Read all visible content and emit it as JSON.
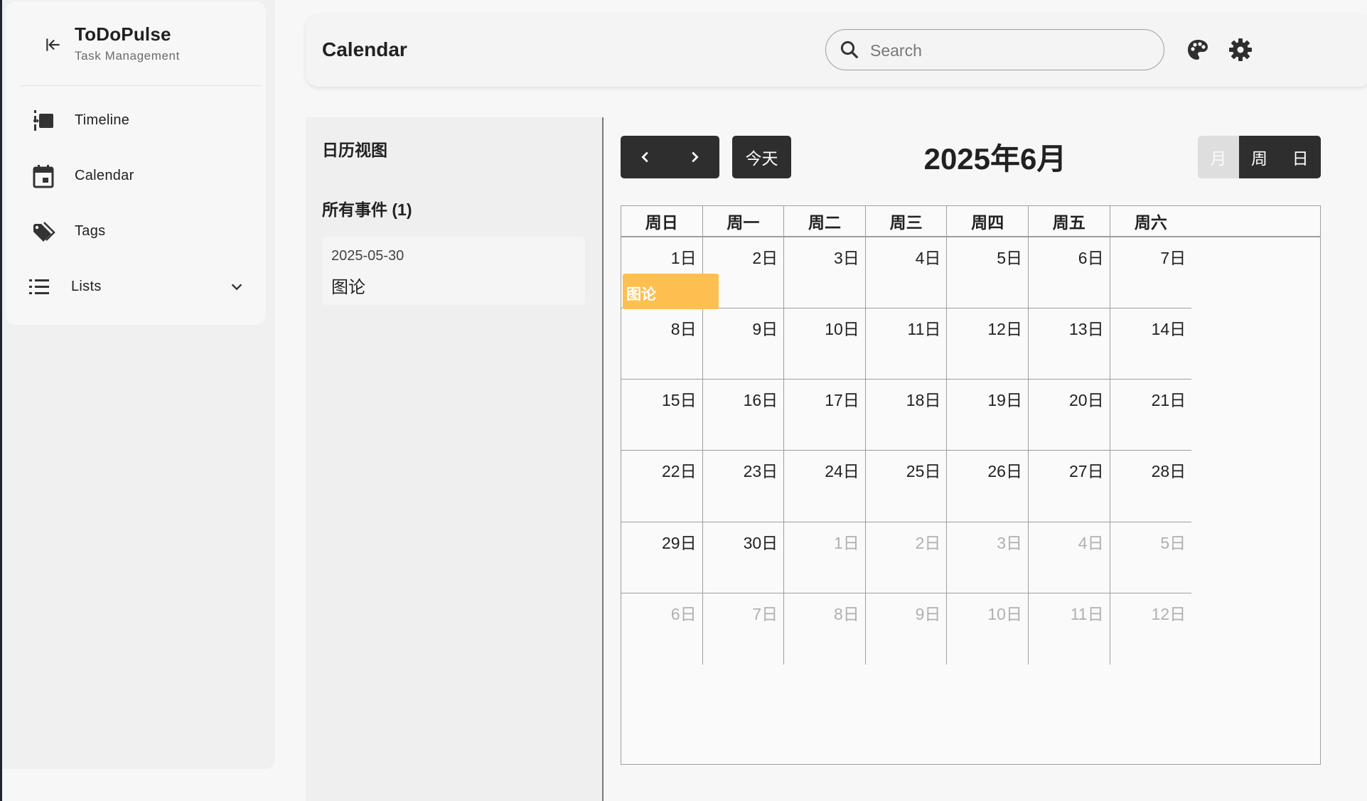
{
  "app": {
    "title": "ToDoPulse",
    "subtitle": "Task Management"
  },
  "sidebar": {
    "items": [
      {
        "label": "Timeline",
        "icon": "timeline-icon"
      },
      {
        "label": "Calendar",
        "icon": "calendar-icon"
      },
      {
        "label": "Tags",
        "icon": "tags-icon"
      },
      {
        "label": "Lists",
        "icon": "list-icon",
        "expandable": true
      }
    ]
  },
  "header": {
    "title": "Calendar",
    "search": {
      "placeholder": "Search",
      "value": ""
    },
    "icons": [
      "palette-icon",
      "settings-icon"
    ]
  },
  "events_panel": {
    "title": "日历视图",
    "all_events_label": "所有事件 (1)",
    "events": [
      {
        "date": "2025-05-30",
        "title": "图论"
      }
    ]
  },
  "calendar": {
    "today_label": "今天",
    "month_title": "2025年6月",
    "views": [
      {
        "label": "月",
        "active": true
      },
      {
        "label": "周",
        "active": false
      },
      {
        "label": "日",
        "active": false
      }
    ],
    "weekdays": [
      "周日",
      "周一",
      "周二",
      "周三",
      "周四",
      "周五",
      "周六"
    ],
    "weeks": [
      [
        {
          "label": "1日",
          "other": false
        },
        {
          "label": "2日",
          "other": false
        },
        {
          "label": "3日",
          "other": false
        },
        {
          "label": "4日",
          "other": false
        },
        {
          "label": "5日",
          "other": false
        },
        {
          "label": "6日",
          "other": false
        },
        {
          "label": "7日",
          "other": false
        }
      ],
      [
        {
          "label": "8日",
          "other": false
        },
        {
          "label": "9日",
          "other": false
        },
        {
          "label": "10日",
          "other": false
        },
        {
          "label": "11日",
          "other": false
        },
        {
          "label": "12日",
          "other": false
        },
        {
          "label": "13日",
          "other": false
        },
        {
          "label": "14日",
          "other": false
        }
      ],
      [
        {
          "label": "15日",
          "other": false
        },
        {
          "label": "16日",
          "other": false
        },
        {
          "label": "17日",
          "other": false
        },
        {
          "label": "18日",
          "other": false
        },
        {
          "label": "19日",
          "other": false
        },
        {
          "label": "20日",
          "other": false
        },
        {
          "label": "21日",
          "other": false
        }
      ],
      [
        {
          "label": "22日",
          "other": false
        },
        {
          "label": "23日",
          "other": false
        },
        {
          "label": "24日",
          "other": false
        },
        {
          "label": "25日",
          "other": false
        },
        {
          "label": "26日",
          "other": false
        },
        {
          "label": "27日",
          "other": false
        },
        {
          "label": "28日",
          "other": false
        }
      ],
      [
        {
          "label": "29日",
          "other": false
        },
        {
          "label": "30日",
          "other": false
        },
        {
          "label": "1日",
          "other": true
        },
        {
          "label": "2日",
          "other": true
        },
        {
          "label": "3日",
          "other": true
        },
        {
          "label": "4日",
          "other": true
        },
        {
          "label": "5日",
          "other": true
        }
      ],
      [
        {
          "label": "6日",
          "other": true
        },
        {
          "label": "7日",
          "other": true
        },
        {
          "label": "8日",
          "other": true
        },
        {
          "label": "9日",
          "other": true
        },
        {
          "label": "10日",
          "other": true
        },
        {
          "label": "11日",
          "other": true
        },
        {
          "label": "12日",
          "other": true
        }
      ]
    ],
    "event_chip": {
      "title": "图论",
      "color": "#fdbf4f"
    }
  }
}
